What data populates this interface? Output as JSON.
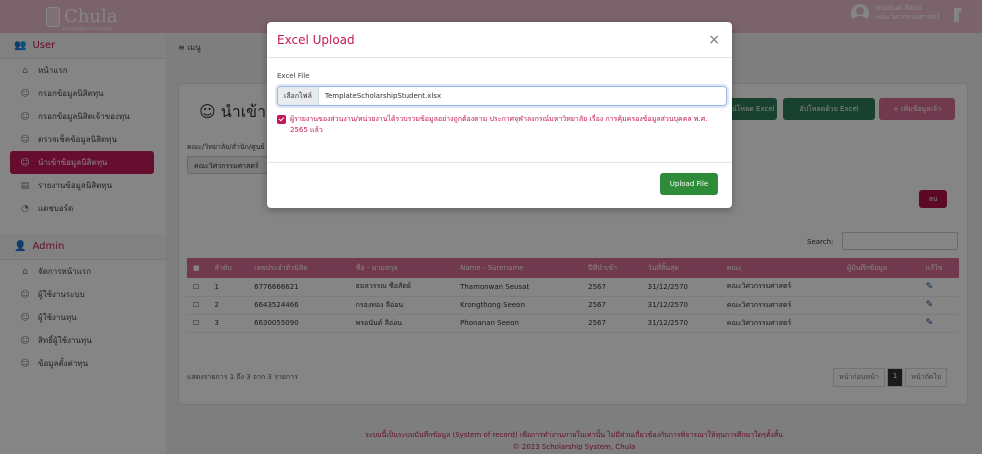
{
  "header": {
    "brand": "Chula",
    "brand_sub": "Chulalongkorn University",
    "user_name": "พรอนันต์ ลีอ่อน",
    "user_faculty": "คณะวิศวกรรมศาสตร์"
  },
  "sidebar": {
    "group_user": "User",
    "items": [
      {
        "icon": "home-icon",
        "label": "หน้าแรก"
      },
      {
        "icon": "user-icon",
        "label": "กรอกข้อมูลนิสิตทุน"
      },
      {
        "icon": "user-icon",
        "label": "กรอกข้อมูลนิสิตเจ้าของทุน"
      },
      {
        "icon": "user-icon",
        "label": "ตรวจเช็คข้อมูลนิสิตทุน"
      },
      {
        "icon": "user-icon",
        "label": "นำเข้าข้อมูลนิสิตทุน",
        "active": true
      },
      {
        "icon": "report-icon",
        "label": "รายงานข้อมูลนิสิตทุน"
      },
      {
        "icon": "dashboard-icon",
        "label": "แดชบอร์ด"
      }
    ],
    "group_admin": "Admin",
    "admin_items": [
      {
        "icon": "home-icon",
        "label": "จัดการหน้าแรก"
      },
      {
        "icon": "user-icon",
        "label": "ผู้ใช้งานระบบ"
      },
      {
        "icon": "user-icon",
        "label": "ผู้ใช้งานทุน"
      },
      {
        "icon": "user-icon",
        "label": "สิทธิ์ผู้ใช้งานทุน"
      },
      {
        "icon": "user-icon",
        "label": "ข้อมูลตั้งค่าทุน"
      }
    ]
  },
  "main": {
    "menu_link": "≡ เมนู",
    "title": "นำเข้าข้อมูลนิสิตทุน",
    "btn_excel": "ดาวน์โหลด Excel",
    "btn_upload_excel": "อัปโหลดด้วย Excel",
    "btn_add": "+ เพิ่มข้อมูลเจ้า",
    "filter_label": "คณะ/วิทยาลัย/สำนัก/ศูนย์",
    "filter_value": "คณะวิศวกรรมศาสตร์",
    "btn_delete": "ลบ",
    "search_label": "Search:",
    "table": {
      "headers": [
        "ลำดับ",
        "เลขประจำตัวนิสิต",
        "ชื่อ - นามสกุล",
        "Name - Surename",
        "ปีที่นำเข้า",
        "วันที่สิ้นสุด",
        "คณะ",
        "ผู้บันทึกข้อมูล",
        "แก้ไข"
      ],
      "rows": [
        [
          "1",
          "6776666621",
          "ธมลวรรณ ซือสัตย์",
          "Thamonwan Seusat",
          "2567",
          "31/12/2570",
          "คณะวิศวกรรมศาสตร์",
          ""
        ],
        [
          "2",
          "6643524466",
          "กรองทอง ลีอ่อน",
          "Krongthong Seeon",
          "2567",
          "31/12/2570",
          "คณะวิศวกรรมศาสตร์",
          ""
        ],
        [
          "3",
          "6630055090",
          "พรอนันต์ ลีอ่อน",
          "Phonanan Seeon",
          "2567",
          "31/12/2570",
          "คณะวิศวกรรมศาสตร์",
          ""
        ]
      ]
    },
    "info": "แสดงรายการ 1 ถึง 3 จาก 3 รายการ",
    "pager": {
      "prev": "หน้าก่อนหน้า",
      "current": "1",
      "next": "หน้าถัดไป"
    },
    "footer_line1": "ระบบนี้เป็นระบบบันทึกข้อมูล (System of record) เพื่อการทำงานภายในเท่านั้น ไม่มีส่วนเกี่ยวข้องกับการพิจารณาให้ทุนการศึกษาใดๆทั้งสิ้น",
    "footer_line2": "© 2023 Scholarship System, Chula"
  },
  "modal": {
    "title": "Excel Upload",
    "close": "×",
    "file_label": "Excel File",
    "browse": "เลือกไฟล์",
    "file_name": "TemplateScholarshipStudent.xlsx",
    "consent": "ผู้รายงานของส่วนงาน/หน่วยงานได้รวบรวมข้อมูลอย่างถูกต้องตาม ประกาศจุฬาลงกรณ์มหาวิทยาลัย เรื่อง การคุ้มครองข้อมูลส่วนบุคคล พ.ศ. 2565 แล้ว",
    "upload": "Upload File"
  }
}
